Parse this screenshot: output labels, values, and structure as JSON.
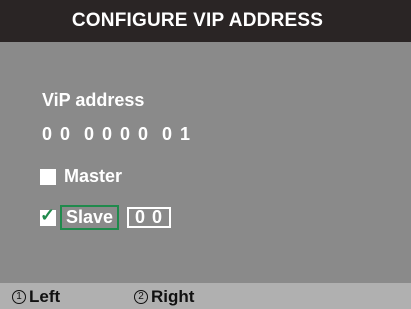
{
  "header": {
    "title": "CONFIGURE VIP ADDRESS"
  },
  "vip": {
    "label": "ViP address",
    "digits": [
      "0",
      "0",
      "0",
      "0",
      "0",
      "0",
      "0",
      "1"
    ]
  },
  "options": {
    "master": {
      "label": "Master",
      "checked": false
    },
    "slave": {
      "label": "Slave",
      "checked": true,
      "checkmark": "✓",
      "value": "0 0"
    }
  },
  "footer": {
    "left": {
      "key": "1",
      "label": "Left"
    },
    "right": {
      "key": "2",
      "label": "Right"
    }
  },
  "colors": {
    "background": "#8a8a8a",
    "title_bar": "#2a2525",
    "footer": "#b0b0b0",
    "focus": "#1f8a4c",
    "text": "#ffffff"
  }
}
